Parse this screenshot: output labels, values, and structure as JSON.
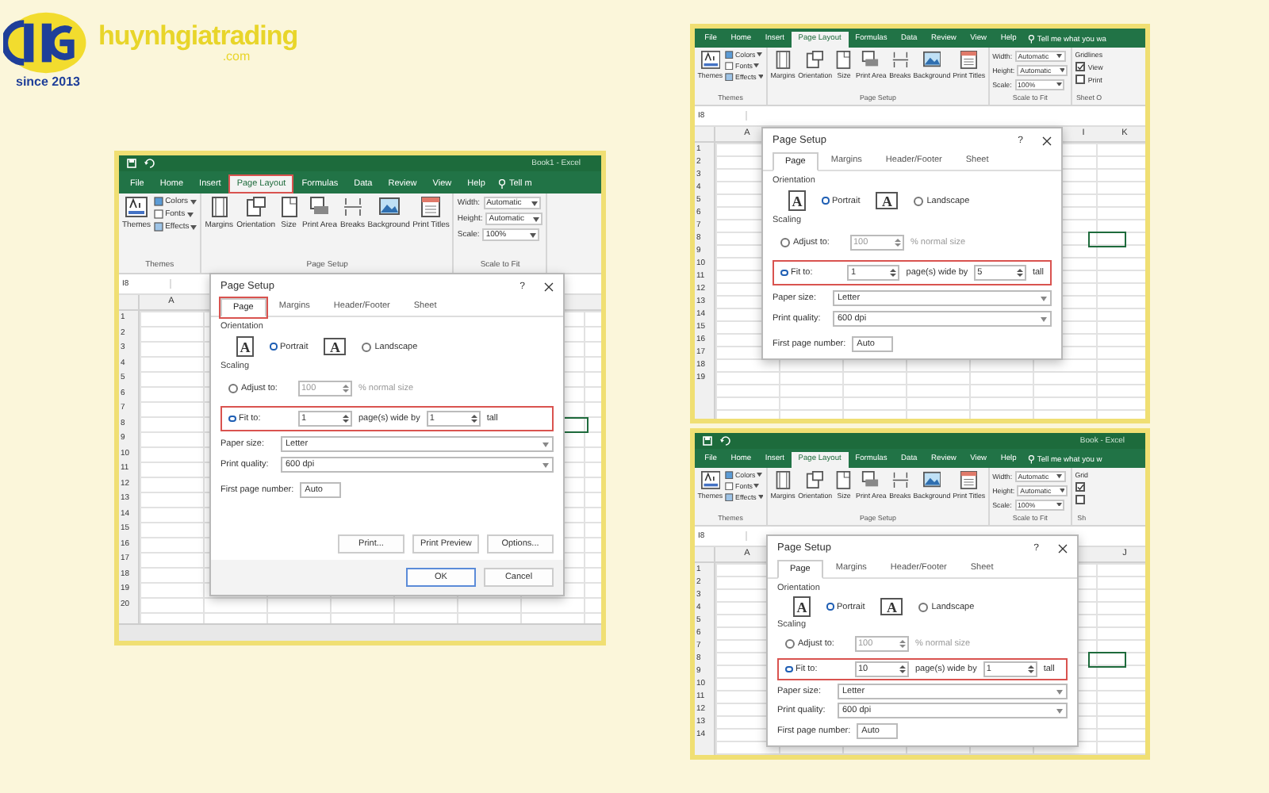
{
  "brand": {
    "name": "huynhgiatrading",
    "domain": ".com",
    "since": "since 2013"
  },
  "panels": [
    {
      "titlebar": {
        "title": "Book1 - Excel"
      },
      "ribbon_tabs": [
        {
          "label": "File",
          "selected": false,
          "highlighted": false
        },
        {
          "label": "Home",
          "selected": false,
          "highlighted": false
        },
        {
          "label": "Insert",
          "selected": false,
          "highlighted": false
        },
        {
          "label": "Page Layout",
          "selected": true,
          "highlighted": true
        },
        {
          "label": "Formulas",
          "selected": false,
          "highlighted": false
        },
        {
          "label": "Data",
          "selected": false,
          "highlighted": false
        },
        {
          "label": "Review",
          "selected": false,
          "highlighted": false
        },
        {
          "label": "View",
          "selected": false,
          "highlighted": false
        },
        {
          "label": "Help",
          "selected": false,
          "highlighted": false
        }
      ],
      "tell_me": "Tell m",
      "themes_group": {
        "label": "Themes",
        "button": "Themes",
        "items": [
          "Colors",
          "Fonts",
          "Effects"
        ]
      },
      "page_setup_group": {
        "label": "Page Setup",
        "buttons": [
          {
            "kind": "margins",
            "label": "Margins"
          },
          {
            "kind": "orientation",
            "label": "Orientation"
          },
          {
            "kind": "size",
            "label": "Size"
          },
          {
            "kind": "print_area",
            "label": "Print Area"
          },
          {
            "kind": "breaks",
            "label": "Breaks"
          },
          {
            "kind": "background",
            "label": "Background"
          },
          {
            "kind": "print_titles",
            "label": "Print Titles"
          }
        ]
      },
      "scale_group": {
        "label": "Scale to Fit",
        "rows": [
          {
            "label": "Width:",
            "value": "Automatic"
          },
          {
            "label": "Height:",
            "value": "Automatic"
          },
          {
            "label": "Scale:",
            "value": "100%"
          }
        ]
      },
      "name_box": "I8",
      "columns": [
        "A"
      ],
      "rows": [
        "1",
        "2",
        "3",
        "4",
        "5",
        "6",
        "7",
        "8",
        "9",
        "10",
        "11",
        "12",
        "13",
        "14",
        "15",
        "16",
        "17",
        "18",
        "19",
        "20"
      ],
      "sheet_tabs": true,
      "dialog": {
        "title": "Page Setup",
        "help": "?",
        "tabs": [
          {
            "label": "Page",
            "selected": true,
            "highlighted": true
          },
          {
            "label": "Margins",
            "selected": false,
            "highlighted": false
          },
          {
            "label": "Header/Footer",
            "selected": false,
            "highlighted": false
          },
          {
            "label": "Sheet",
            "selected": false,
            "highlighted": false
          }
        ],
        "orientation_label": "Orientation",
        "orientations": [
          {
            "glyph": "A",
            "label": "Portrait",
            "selected": true
          },
          {
            "glyph": "A",
            "label": "Landscape",
            "selected": false
          }
        ],
        "scaling_label": "Scaling",
        "adjust": {
          "label": "Adjust to:",
          "value": "100",
          "suffix": "% normal size",
          "selected": false,
          "disabled": true
        },
        "fit": {
          "label": "Fit to:",
          "wide": "1",
          "wide_label": "page(s) wide by",
          "tall": "1",
          "tall_label": "tall",
          "selected": true,
          "highlighted": true
        },
        "selects": [
          {
            "label": "Paper size:",
            "value": "Letter"
          },
          {
            "label": "Print quality:",
            "value": "600 dpi"
          }
        ],
        "first_page": {
          "label": "First page number:",
          "value": "Auto"
        },
        "buttons": [
          "Print...",
          "Print Preview",
          "Options..."
        ],
        "footer": [
          "OK",
          "Cancel"
        ]
      }
    },
    {
      "ribbon_tabs": [
        {
          "label": "File",
          "selected": false,
          "highlighted": false
        },
        {
          "label": "Home",
          "selected": false,
          "highlighted": false
        },
        {
          "label": "Insert",
          "selected": false,
          "highlighted": false
        },
        {
          "label": "Page Layout",
          "selected": true,
          "highlighted": false
        },
        {
          "label": "Formulas",
          "selected": false,
          "highlighted": false
        },
        {
          "label": "Data",
          "selected": false,
          "highlighted": false
        },
        {
          "label": "Review",
          "selected": false,
          "highlighted": false
        },
        {
          "label": "View",
          "selected": false,
          "highlighted": false
        },
        {
          "label": "Help",
          "selected": false,
          "highlighted": false
        }
      ],
      "tell_me": "Tell me what you wa",
      "themes_group": {
        "label": "Themes",
        "button": "Themes",
        "items": [
          "Colors",
          "Fonts",
          "Effects"
        ]
      },
      "page_setup_group": {
        "label": "Page Setup",
        "buttons": [
          {
            "kind": "margins",
            "label": "Margins"
          },
          {
            "kind": "orientation",
            "label": "Orientation"
          },
          {
            "kind": "size",
            "label": "Size"
          },
          {
            "kind": "print_area",
            "label": "Print Area"
          },
          {
            "kind": "breaks",
            "label": "Breaks"
          },
          {
            "kind": "background",
            "label": "Background"
          },
          {
            "kind": "print_titles",
            "label": "Print Titles"
          }
        ]
      },
      "scale_group": {
        "label": "Scale to Fit",
        "rows": [
          {
            "label": "Width:",
            "value": "Automatic"
          },
          {
            "label": "Height:",
            "value": "Automatic"
          },
          {
            "label": "Scale:",
            "value": "100%"
          }
        ]
      },
      "sheet_group": {
        "label": "Sheet O",
        "heading": "Gridlines",
        "checks": [
          {
            "label": "View",
            "checked": true
          },
          {
            "label": "Print",
            "checked": false
          }
        ]
      },
      "name_box": "I8",
      "columns": [
        "A",
        "I",
        "K"
      ],
      "rows": [
        "1",
        "2",
        "3",
        "4",
        "5",
        "6",
        "7",
        "8",
        "9",
        "10",
        "11",
        "12",
        "13",
        "14",
        "15",
        "16",
        "17",
        "18",
        "19"
      ],
      "sheet_tabs": false,
      "dialog": {
        "title": "Page Setup",
        "help": "?",
        "tabs": [
          {
            "label": "Page",
            "selected": true,
            "highlighted": false
          },
          {
            "label": "Margins",
            "selected": false,
            "highlighted": false
          },
          {
            "label": "Header/Footer",
            "selected": false,
            "highlighted": false
          },
          {
            "label": "Sheet",
            "selected": false,
            "highlighted": false
          }
        ],
        "orientation_label": "Orientation",
        "orientations": [
          {
            "glyph": "A",
            "label": "Portrait",
            "selected": true
          },
          {
            "glyph": "A",
            "label": "Landscape",
            "selected": false
          }
        ],
        "scaling_label": "Scaling",
        "adjust": {
          "label": "Adjust to:",
          "value": "100",
          "suffix": "% normal size",
          "selected": false,
          "disabled": true
        },
        "fit": {
          "label": "Fit to:",
          "wide": "1",
          "wide_label": "page(s) wide by",
          "tall": "5",
          "tall_label": "tall",
          "selected": true,
          "highlighted": true
        },
        "selects": [
          {
            "label": "Paper size:",
            "value": "Letter"
          },
          {
            "label": "Print quality:",
            "value": "600 dpi"
          }
        ],
        "first_page": {
          "label": "First page number:",
          "value": "Auto"
        }
      }
    },
    {
      "titlebar": {
        "title": "Book - Excel"
      },
      "ribbon_tabs": [
        {
          "label": "File",
          "selected": false,
          "highlighted": false
        },
        {
          "label": "Home",
          "selected": false,
          "highlighted": false
        },
        {
          "label": "Insert",
          "selected": false,
          "highlighted": false
        },
        {
          "label": "Page Layout",
          "selected": true,
          "highlighted": false
        },
        {
          "label": "Formulas",
          "selected": false,
          "highlighted": false
        },
        {
          "label": "Data",
          "selected": false,
          "highlighted": false
        },
        {
          "label": "Review",
          "selected": false,
          "highlighted": false
        },
        {
          "label": "View",
          "selected": false,
          "highlighted": false
        },
        {
          "label": "Help",
          "selected": false,
          "highlighted": false
        }
      ],
      "tell_me": "Tell me what you w",
      "themes_group": {
        "label": "Themes",
        "button": "Themes",
        "items": [
          "Colors",
          "Fonts",
          "Effects"
        ]
      },
      "page_setup_group": {
        "label": "Page Setup",
        "buttons": [
          {
            "kind": "margins",
            "label": "Margins"
          },
          {
            "kind": "orientation",
            "label": "Orientation"
          },
          {
            "kind": "size",
            "label": "Size"
          },
          {
            "kind": "print_area",
            "label": "Print Area"
          },
          {
            "kind": "breaks",
            "label": "Breaks"
          },
          {
            "kind": "background",
            "label": "Background"
          },
          {
            "kind": "print_titles",
            "label": "Print Titles"
          }
        ]
      },
      "scale_group": {
        "label": "Scale to Fit",
        "rows": [
          {
            "label": "Width:",
            "value": "Automatic"
          },
          {
            "label": "Height:",
            "value": "Automatic"
          },
          {
            "label": "Scale:",
            "value": "100%"
          }
        ]
      },
      "sheet_group": {
        "label": "Sh",
        "heading": "Grid",
        "checks": [
          {
            "checked": true
          },
          {
            "checked": false
          }
        ]
      },
      "name_box": "I8",
      "columns": [
        "A",
        "J"
      ],
      "rows": [
        "1",
        "2",
        "3",
        "4",
        "5",
        "6",
        "7",
        "8",
        "9",
        "10",
        "11",
        "12",
        "13",
        "14"
      ],
      "sheet_tabs": false,
      "dialog": {
        "title": "Page Setup",
        "help": "?",
        "tabs": [
          {
            "label": "Page",
            "selected": true,
            "highlighted": false
          },
          {
            "label": "Margins",
            "selected": false,
            "highlighted": false
          },
          {
            "label": "Header/Footer",
            "selected": false,
            "highlighted": false
          },
          {
            "label": "Sheet",
            "selected": false,
            "highlighted": false
          }
        ],
        "orientation_label": "Orientation",
        "orientations": [
          {
            "glyph": "A",
            "label": "Portrait",
            "selected": true
          },
          {
            "glyph": "A",
            "label": "Landscape",
            "selected": false
          }
        ],
        "scaling_label": "Scaling",
        "adjust": {
          "label": "Adjust to:",
          "value": "100",
          "suffix": "% normal size",
          "selected": false,
          "disabled": true
        },
        "fit": {
          "label": "Fit to:",
          "wide": "10",
          "wide_label": "page(s) wide by",
          "tall": "1",
          "tall_label": "tall",
          "selected": true,
          "highlighted": true
        },
        "selects": [
          {
            "label": "Paper size:",
            "value": "Letter"
          },
          {
            "label": "Print quality:",
            "value": "600 dpi"
          }
        ],
        "first_page": {
          "label": "First page number:",
          "value": "Auto"
        }
      }
    }
  ]
}
